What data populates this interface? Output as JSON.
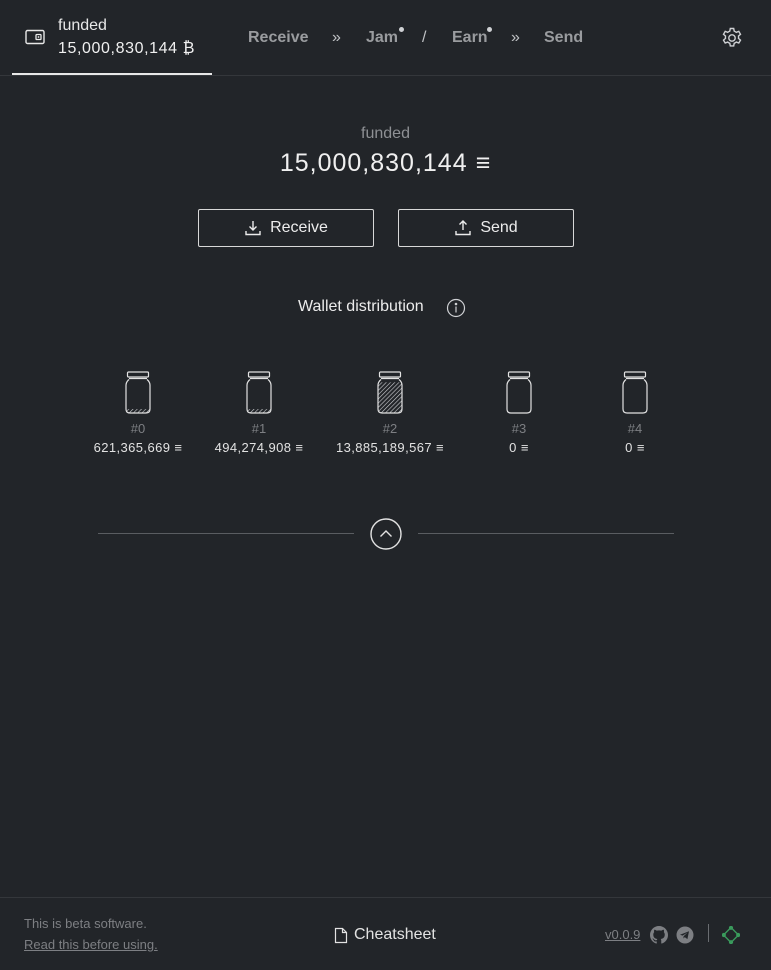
{
  "navbar": {
    "wallet_name": "funded",
    "wallet_balance": "15,000,830,144 ₿",
    "links": {
      "receive": "Receive",
      "sep1": "»",
      "jam": "Jam",
      "sep2": "/",
      "earn": "Earn",
      "sep3": "»",
      "send": "Send"
    },
    "icons": {
      "wallet": "wallet-icon",
      "settings": "gear-icon"
    }
  },
  "main": {
    "wallet_name": "funded",
    "balance": "15,000,830,144",
    "balance_unit": "≡",
    "receive_label": "Receive",
    "send_label": "Send",
    "distribution_title": "Wallet distribution"
  },
  "jars": [
    {
      "index": "#0",
      "balance": "621,365,669",
      "fill": 0.04
    },
    {
      "index": "#1",
      "balance": "494,274,908",
      "fill": 0.03
    },
    {
      "index": "#2",
      "balance": "13,885,189,567",
      "fill": 0.93
    },
    {
      "index": "#3",
      "balance": "0",
      "fill": 0
    },
    {
      "index": "#4",
      "balance": "0",
      "fill": 0
    }
  ],
  "footer": {
    "beta_text": "This is beta software.",
    "read_link": "Read this before using.",
    "cheatsheet": "Cheatsheet",
    "version": "v0.0.9"
  },
  "colors": {
    "background": "#222529",
    "text": "#e8e8e8",
    "muted": "#7d7f83",
    "accent_green": "#3a9a5c"
  }
}
